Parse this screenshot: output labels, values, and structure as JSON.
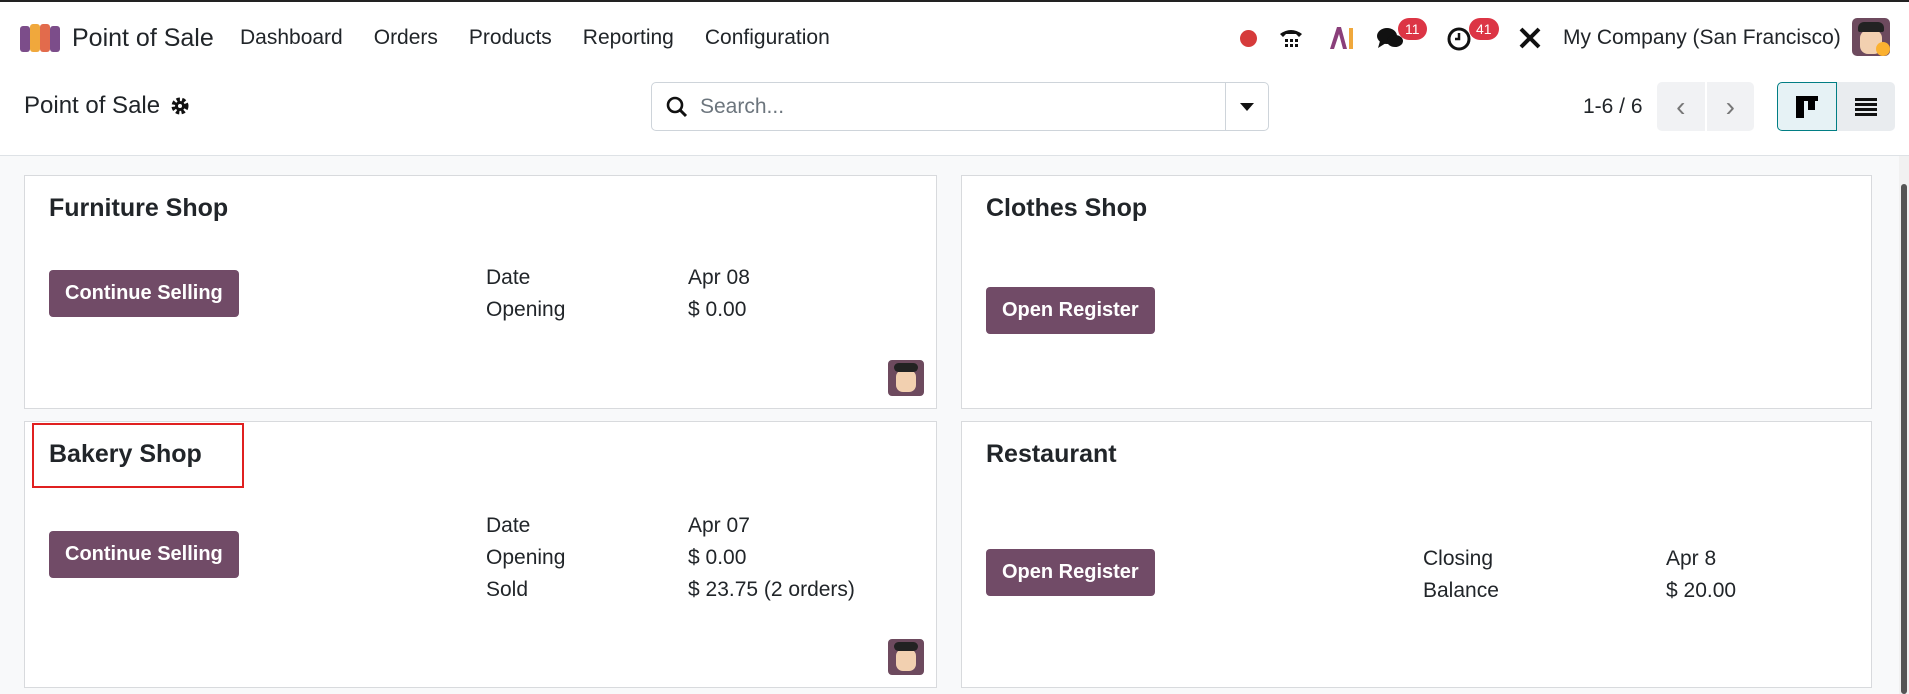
{
  "navbar": {
    "app_name": "Point of Sale",
    "menu": [
      "Dashboard",
      "Orders",
      "Products",
      "Reporting",
      "Configuration"
    ],
    "messages_badge": "11",
    "activities_badge": "41",
    "company": "My Company (San Francisco)"
  },
  "control": {
    "title": "Point of Sale",
    "search_placeholder": "Search...",
    "pager": "1-6 / 6"
  },
  "cards": [
    {
      "title": "Furniture Shop",
      "button": "Continue Selling",
      "info": [
        {
          "k": "Date",
          "v": "Apr 08"
        },
        {
          "k": "Opening",
          "v": "$ 0.00"
        }
      ]
    },
    {
      "title": "Clothes Shop",
      "button": "Open Register",
      "info": []
    },
    {
      "title": "Bakery Shop",
      "button": "Continue Selling",
      "info": [
        {
          "k": "Date",
          "v": "Apr 07"
        },
        {
          "k": "Opening",
          "v": "$ 0.00"
        },
        {
          "k": "Sold",
          "v": "$ 23.75 (2 orders)"
        }
      ]
    },
    {
      "title": "Restaurant",
      "button": "Open Register",
      "info": [
        {
          "k": "Closing",
          "v": "Apr 8"
        },
        {
          "k": "Balance",
          "v": "$ 20.00"
        }
      ]
    }
  ],
  "colors": {
    "primary": "#714b67",
    "badge": "#dc3545",
    "highlight": "#e02020"
  }
}
